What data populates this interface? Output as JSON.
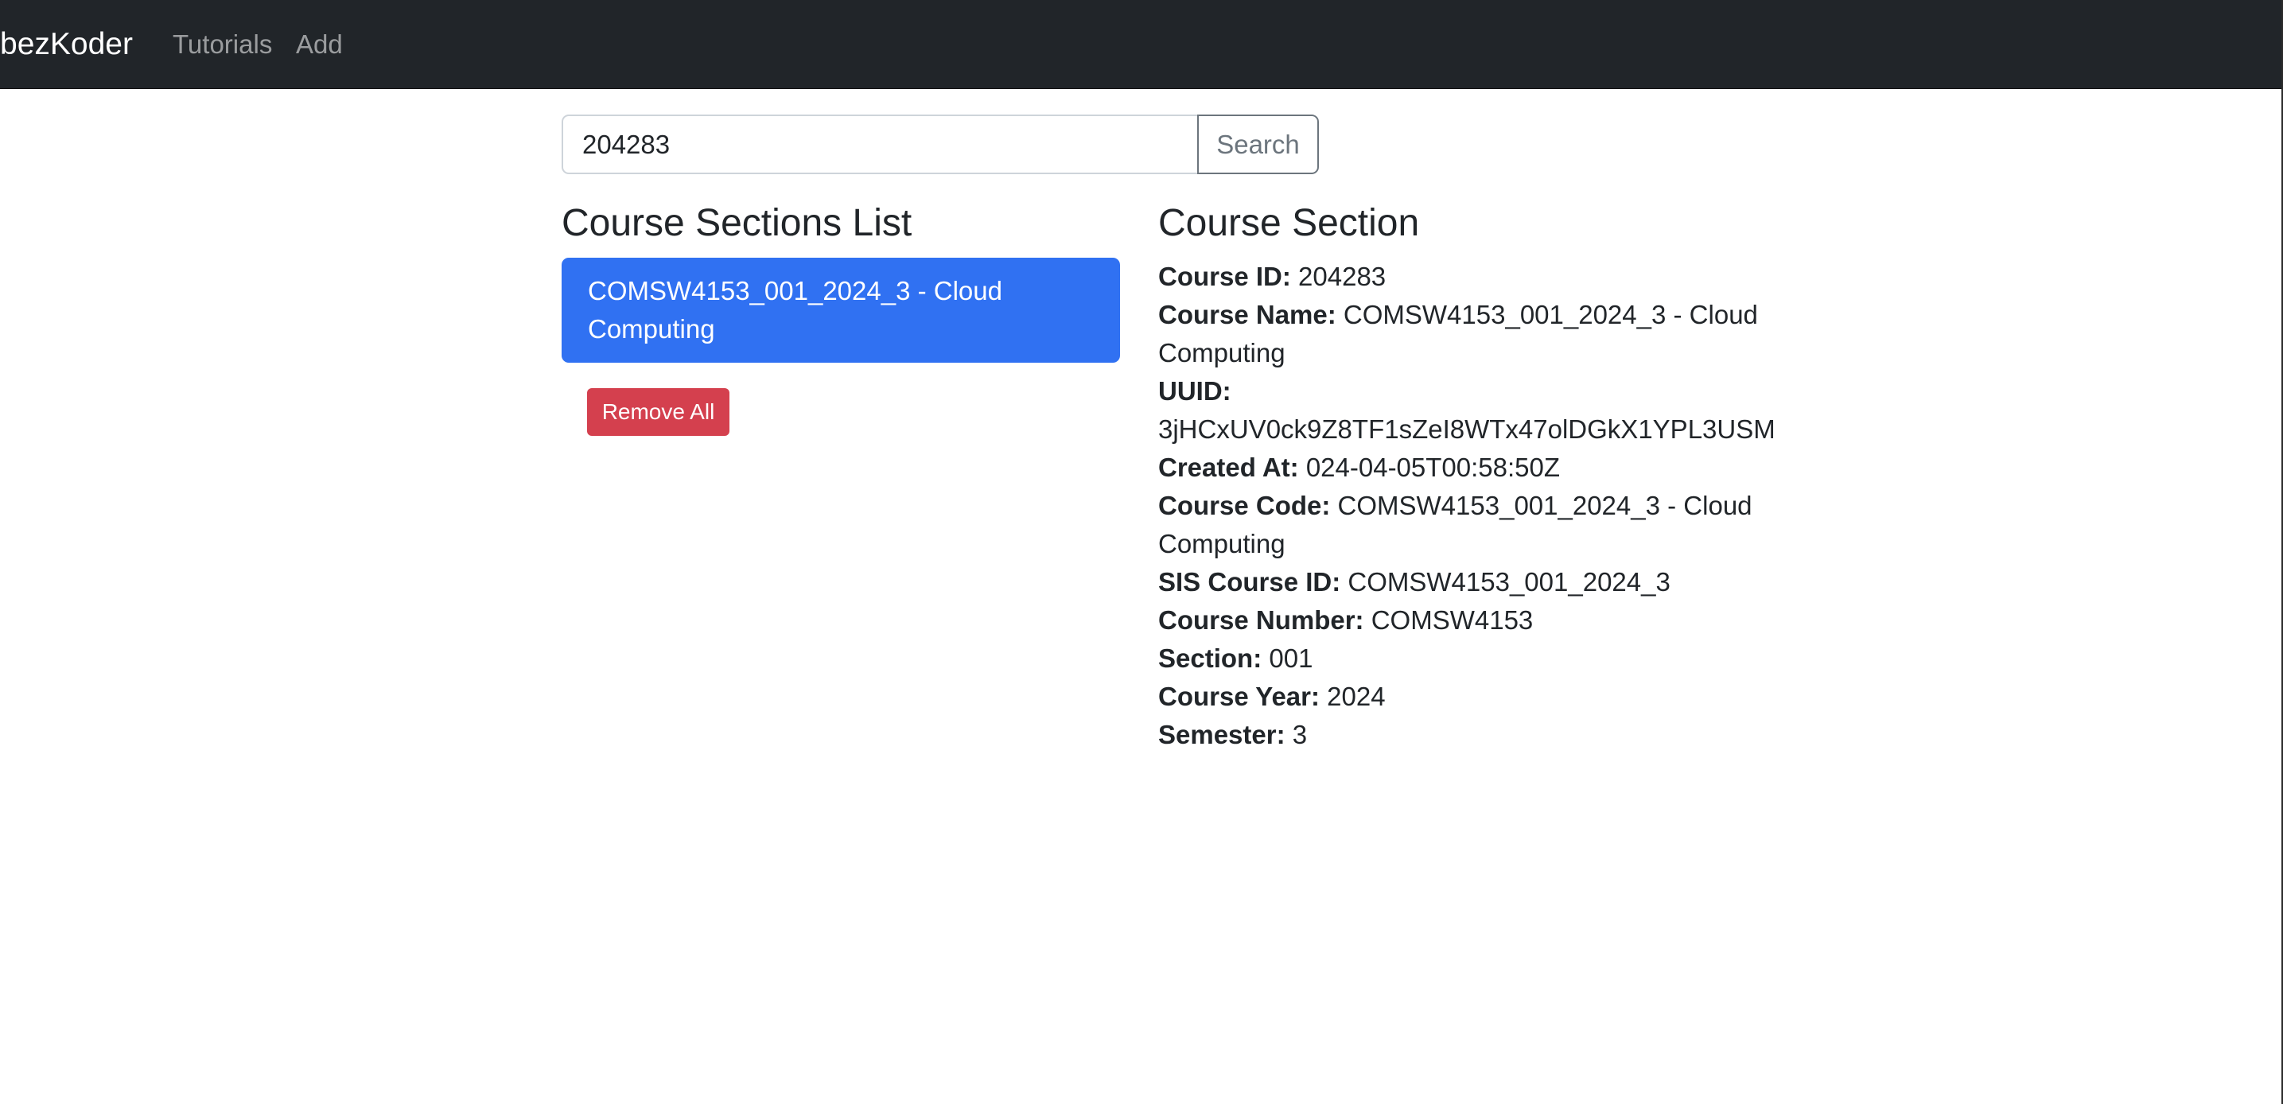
{
  "navbar": {
    "brand": "bezKoder",
    "links": [
      "Tutorials",
      "Add"
    ]
  },
  "search": {
    "value": "204283",
    "button_label": "Search"
  },
  "list": {
    "title": "Course Sections List",
    "items": [
      "COMSW4153_001_2024_3 - Cloud Computing"
    ],
    "remove_all_label": "Remove All"
  },
  "details": {
    "title": "Course Section",
    "fields": [
      {
        "label": "Course ID:",
        "value": "204283"
      },
      {
        "label": "Course Name:",
        "value": "COMSW4153_001_2024_3 - Cloud Computing"
      },
      {
        "label": "UUID:",
        "value": "3jHCxUV0ck9Z8TF1sZeI8WTx47olDGkX1YPL3USM"
      },
      {
        "label": "Created At:",
        "value": "024-04-05T00:58:50Z"
      },
      {
        "label": "Course Code:",
        "value": "COMSW4153_001_2024_3 - Cloud Computing"
      },
      {
        "label": "SIS Course ID:",
        "value": "COMSW4153_001_2024_3"
      },
      {
        "label": "Course Number:",
        "value": "COMSW4153"
      },
      {
        "label": "Section:",
        "value": "001"
      },
      {
        "label": "Course Year:",
        "value": "2024"
      },
      {
        "label": "Semester:",
        "value": "3"
      }
    ]
  },
  "colors": {
    "navbar_bg": "#212529",
    "active_item": "#3071f2",
    "danger": "#d4404e",
    "secondary": "#6c757d"
  }
}
